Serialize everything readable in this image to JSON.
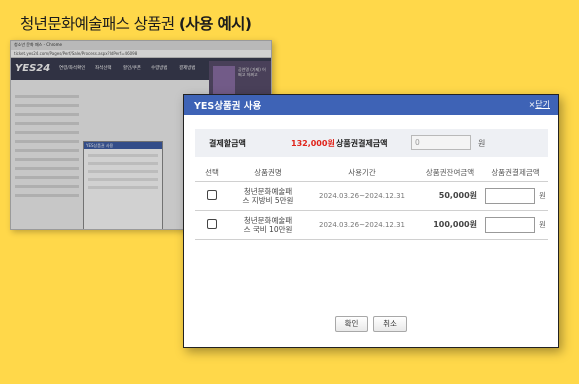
{
  "title": {
    "main": "청년문화예술패스 상품권",
    "paren": "(사용 예시)"
  },
  "background": {
    "window_title": "청소년 문화 패스 - Chrome",
    "address": "ticket.yes24.com/Pages/Perf/Sale/Process.aspx?IdPerf=46098",
    "logo": "YES24",
    "menu": [
      "연령/좌석확인",
      "좌석선택",
      "할인/쿠폰",
      "수령방법",
      "결제방법"
    ],
    "banner_text": "공연명 (가제) 어쩌고 저쩌고",
    "small_popup_title": "YES상품권 사용"
  },
  "popup": {
    "title": "YES상품권 사용",
    "close_x": "×",
    "close_label": "닫기",
    "payment_amount_label": "결제할금액",
    "payment_amount": "132,000원",
    "voucher_payment_label": "상품권결제금액",
    "voucher_payment_value": "0",
    "voucher_payment_unit": "원",
    "columns": [
      "선택",
      "상품권명",
      "사용기간",
      "상품권잔여금액",
      "상품권결제금액"
    ],
    "rows": [
      {
        "name": "청년문화예술패\n스 지방비 5만원",
        "period": "2024.03.26~2024.12.31",
        "balance": "50,000원",
        "unit": "원"
      },
      {
        "name": "청년문화예술패\n스 국비 10만원",
        "period": "2024.03.26~2024.12.31",
        "balance": "100,000원",
        "unit": "원"
      }
    ],
    "confirm_label": "확인",
    "cancel_label": "취소"
  },
  "colors": {
    "background": "#FFD84A",
    "header": "#3e63b6",
    "amount": "#e0231a"
  }
}
